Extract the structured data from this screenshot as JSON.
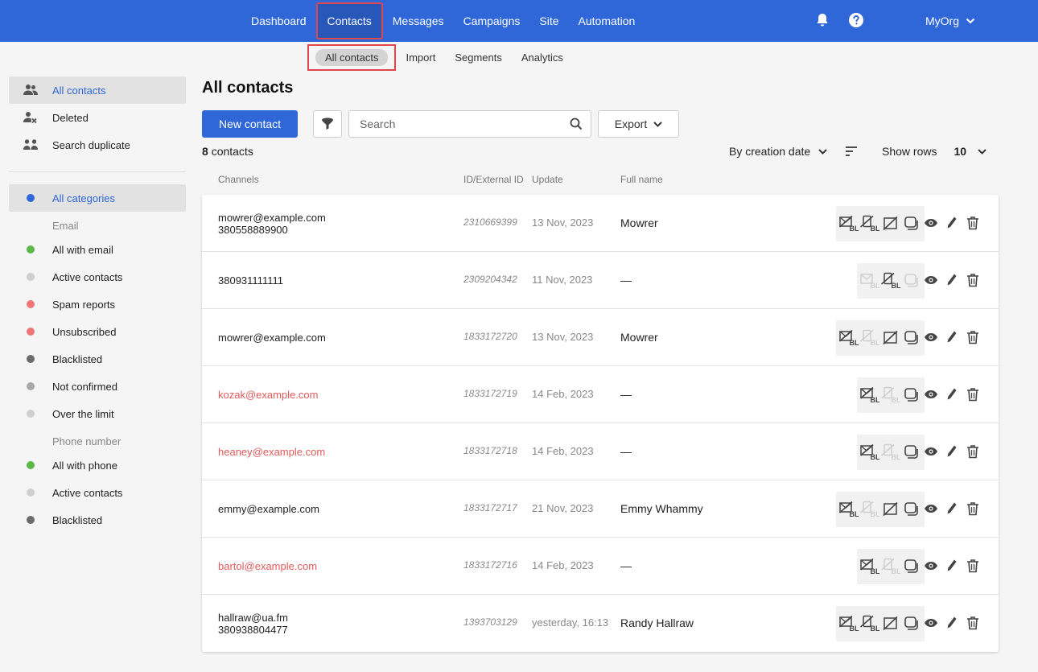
{
  "topnav": {
    "items": [
      "Dashboard",
      "Contacts",
      "Messages",
      "Campaigns",
      "Site",
      "Automation"
    ],
    "active": "Contacts",
    "org": "MyOrg",
    "icons": [
      "bell-icon",
      "help-icon"
    ]
  },
  "subnav": {
    "items": [
      "All contacts",
      "Import",
      "Segments",
      "Analytics"
    ],
    "active": "All contacts"
  },
  "sidebar": {
    "top": [
      {
        "label": "All contacts",
        "icon": "users-icon",
        "selected": true
      },
      {
        "label": "Deleted",
        "icon": "user-x-icon",
        "selected": false
      },
      {
        "label": "Search duplicate",
        "icon": "duplicate-users-icon",
        "selected": false
      }
    ],
    "categories": {
      "label": "All categories",
      "color": "#2f67d8"
    },
    "email_heading": "Email",
    "email": [
      {
        "label": "All with email",
        "color": "#5bb848"
      },
      {
        "label": "Active contacts",
        "color": "#cfcfcf"
      },
      {
        "label": "Spam reports",
        "color": "#ef7676"
      },
      {
        "label": "Unsubscribed",
        "color": "#ef7676"
      },
      {
        "label": "Blacklisted",
        "color": "#6b6b6b"
      },
      {
        "label": "Not confirmed",
        "color": "#a8a8a8"
      },
      {
        "label": "Over the limit",
        "color": "#cfcfcf"
      }
    ],
    "phone_heading": "Phone number",
    "phone": [
      {
        "label": "All with phone",
        "color": "#5bb848"
      },
      {
        "label": "Active contacts",
        "color": "#cfcfcf"
      },
      {
        "label": "Blacklisted",
        "color": "#6b6b6b"
      }
    ]
  },
  "main": {
    "title": "All contacts",
    "new_contact": "New contact",
    "search_placeholder": "Search",
    "export": "Export",
    "count_num": "8",
    "count_label": "contacts",
    "sort_label": "By creation date",
    "show_rows_label": "Show rows",
    "show_rows_value": "10",
    "columns": [
      "Channels",
      "ID/External ID",
      "Update",
      "Full name"
    ]
  },
  "contacts": [
    {
      "email": "mowrer@example.com",
      "phone": "380558889900",
      "email_red": false,
      "id": "2310669399",
      "update": "13 Nov, 2023",
      "name": "Mowrer",
      "channels": [
        "email-bl",
        "sms-bl",
        "viber-off",
        "chat"
      ],
      "disabled": []
    },
    {
      "email": "",
      "phone": "380931111111",
      "email_red": false,
      "id": "2309204342",
      "update": "11 Nov, 2023",
      "name": "—",
      "channels": [
        "email",
        "sms-bl",
        "chat"
      ],
      "disabled": [
        0,
        2
      ]
    },
    {
      "email": "mowrer@example.com",
      "phone": "",
      "email_red": false,
      "id": "1833172720",
      "update": "13 Nov, 2023",
      "name": "Mowrer",
      "channels": [
        "email-bl",
        "sms-bl",
        "viber-off",
        "chat"
      ],
      "disabled": [
        1
      ]
    },
    {
      "email": "kozak@example.com",
      "phone": "",
      "email_red": true,
      "id": "1833172719",
      "update": "14 Feb, 2023",
      "name": "—",
      "channels": [
        "email-bl",
        "sms-bl",
        "chat"
      ],
      "disabled": [
        1
      ]
    },
    {
      "email": "heaney@example.com",
      "phone": "",
      "email_red": true,
      "id": "1833172718",
      "update": "14 Feb, 2023",
      "name": "—",
      "channels": [
        "email-bl",
        "sms-bl",
        "chat"
      ],
      "disabled": [
        1
      ]
    },
    {
      "email": "emmy@example.com",
      "phone": "",
      "email_red": false,
      "id": "1833172717",
      "update": "21 Nov, 2023",
      "name": "Emmy Whammy",
      "channels": [
        "email-bl",
        "sms-bl",
        "viber-off",
        "chat"
      ],
      "disabled": [
        1
      ]
    },
    {
      "email": "bartol@example.com",
      "phone": "",
      "email_red": true,
      "id": "1833172716",
      "update": "14 Feb, 2023",
      "name": "—",
      "channels": [
        "email-bl",
        "sms-bl",
        "chat"
      ],
      "disabled": [
        1
      ]
    },
    {
      "email": "hallraw@ua.fm",
      "phone": "380938804477",
      "email_red": false,
      "id": "1393703129",
      "update": "yesterday, 16:13",
      "name": "Randy Hallraw",
      "channels": [
        "email-bl",
        "sms-bl",
        "viber-off",
        "chat"
      ],
      "disabled": []
    }
  ],
  "row_actions": [
    "view-icon",
    "edit-icon",
    "delete-icon"
  ]
}
